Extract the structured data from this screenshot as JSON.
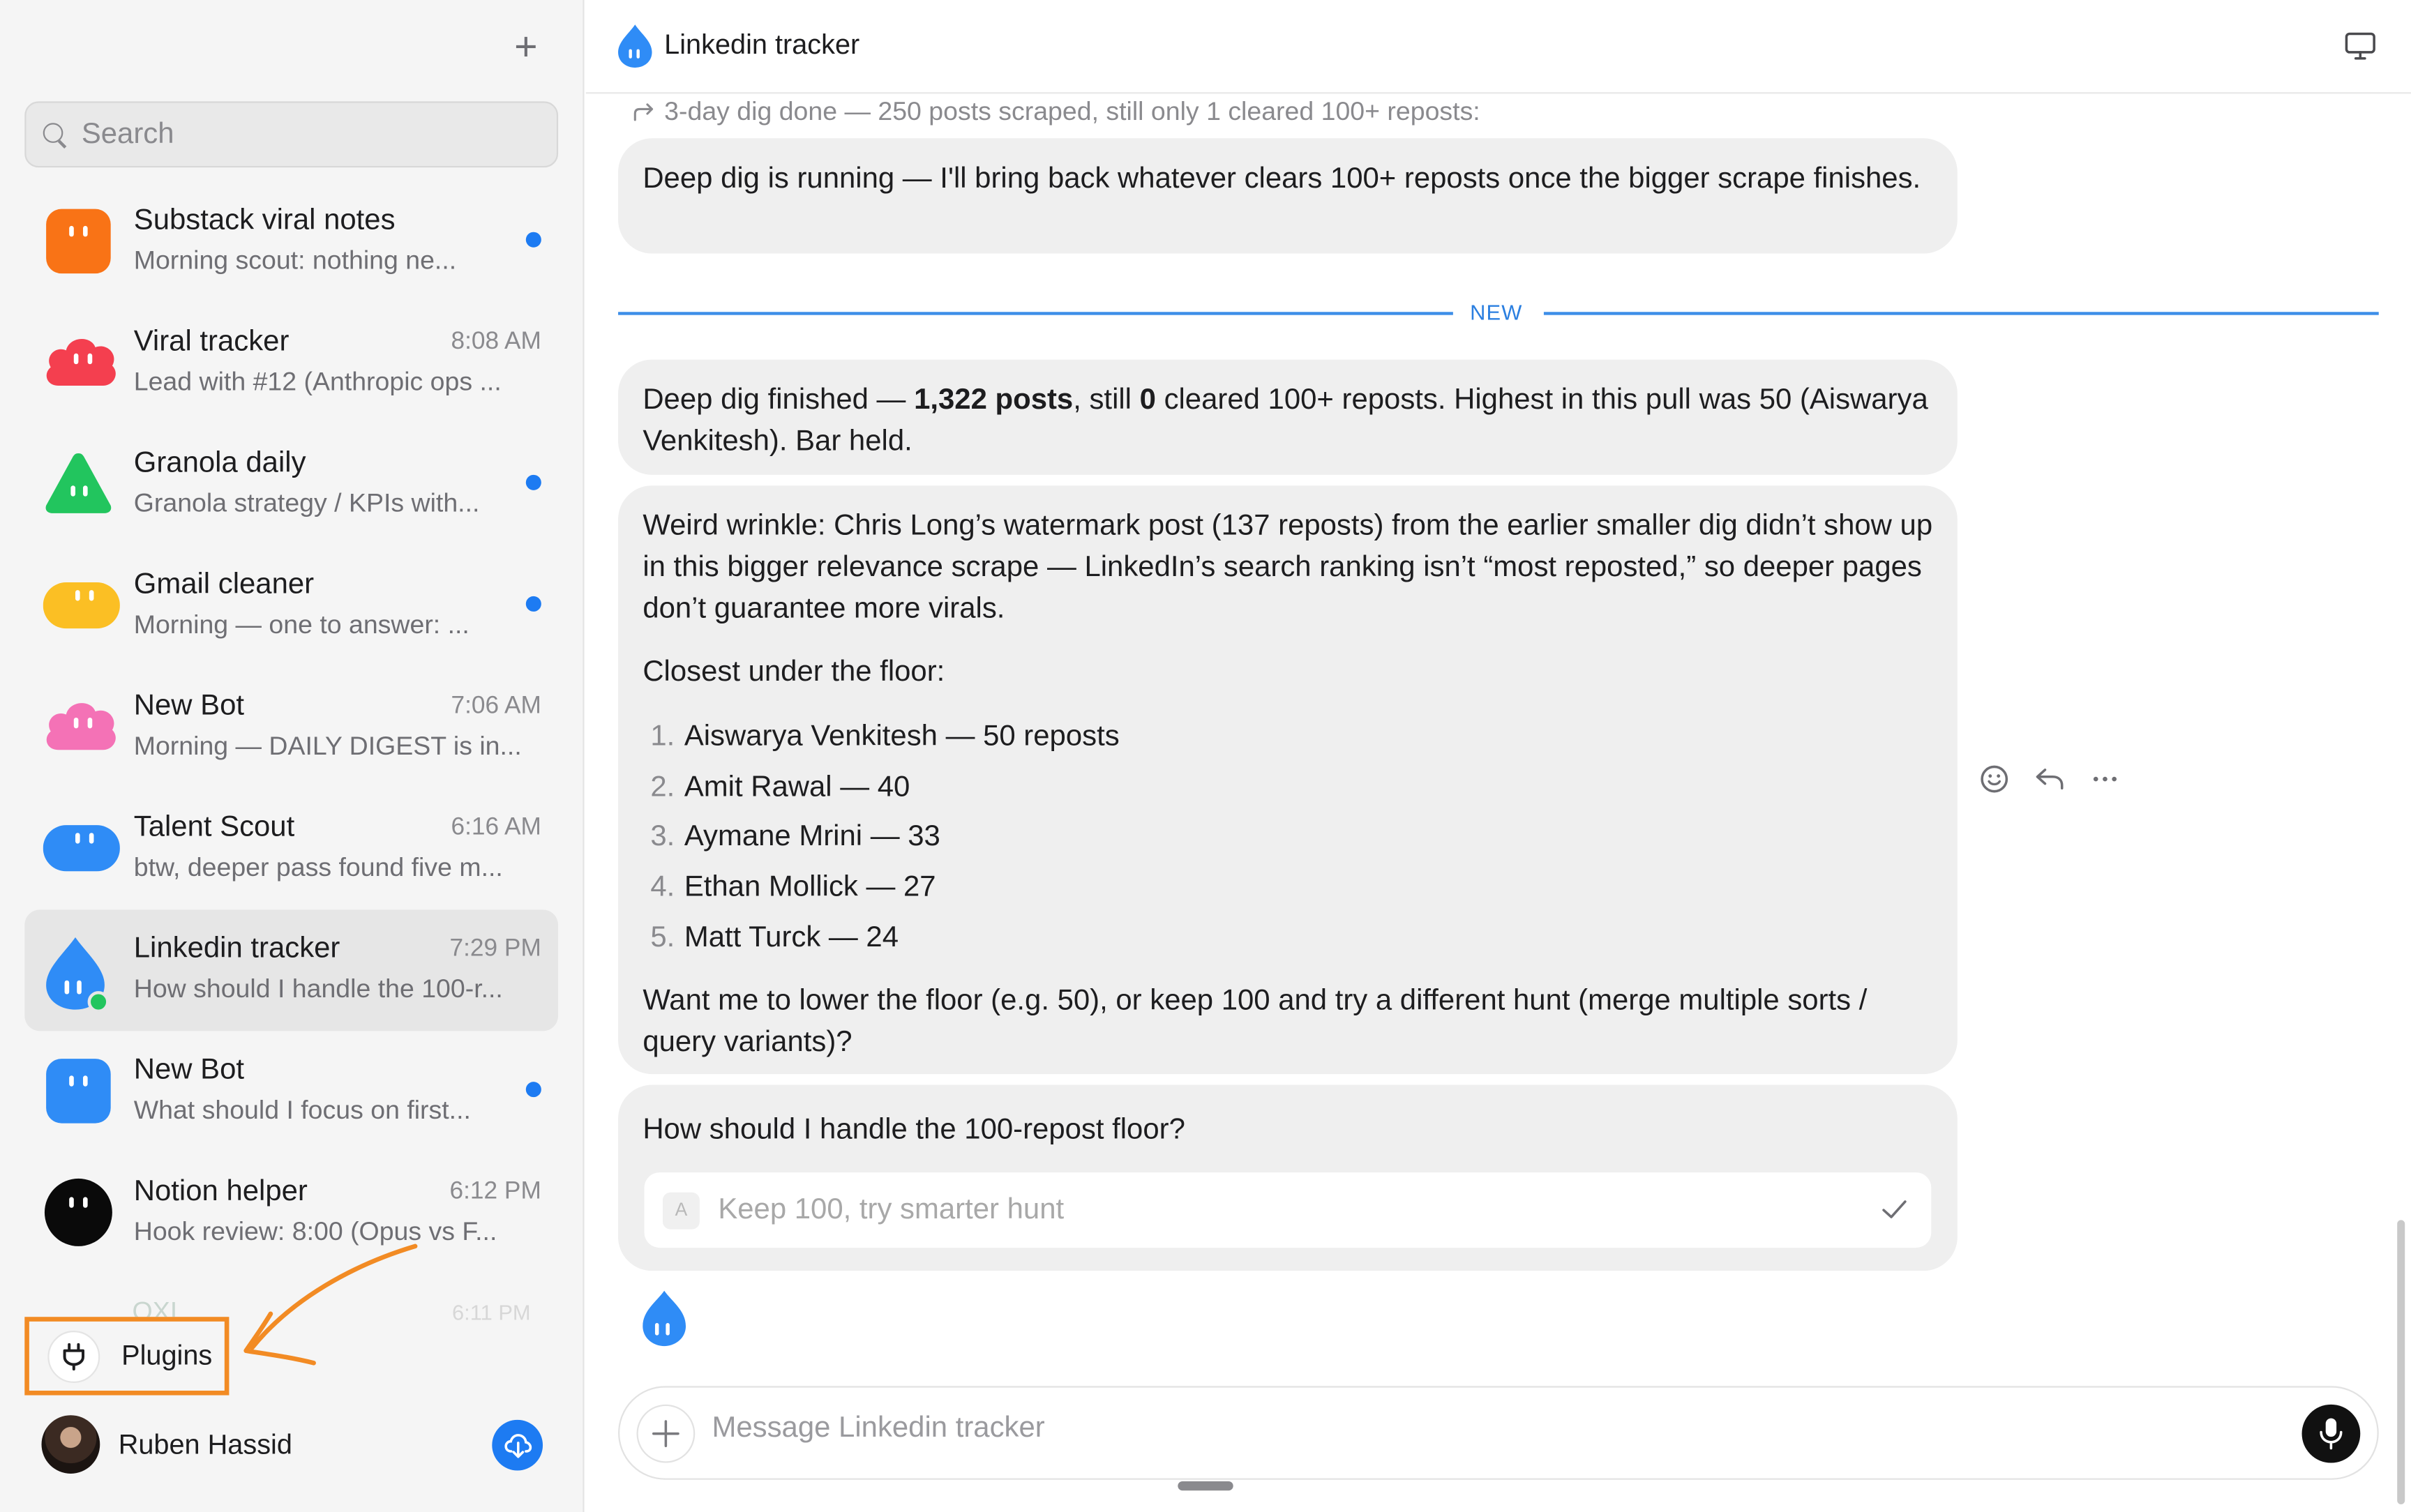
{
  "sidebar": {
    "new_chat_label": "+",
    "search": {
      "placeholder": "Search"
    },
    "chats": [
      {
        "name": "Substack viral notes",
        "preview": "Morning scout: nothing ne...",
        "time": "",
        "unread": true,
        "avatar_color": "#f97316",
        "avatar_shape": "rounded-square"
      },
      {
        "name": "Viral tracker",
        "preview": "Lead with #12 (Anthropic ops ...",
        "time": "8:08 AM",
        "unread": false,
        "avatar_color": "#f43f4f",
        "avatar_shape": "cloud"
      },
      {
        "name": "Granola daily",
        "preview": "Granola strategy / KPIs with...",
        "time": "",
        "unread": true,
        "avatar_color": "#22c55e",
        "avatar_shape": "triangle"
      },
      {
        "name": "Gmail cleaner",
        "preview": "Morning — one to answer: ...",
        "time": "",
        "unread": true,
        "avatar_color": "#fbbf24",
        "avatar_shape": "pill"
      },
      {
        "name": "New Bot",
        "preview": "Morning — DAILY DIGEST is in...",
        "time": "7:06 AM",
        "unread": false,
        "avatar_color": "#f472b6",
        "avatar_shape": "cloud"
      },
      {
        "name": "Talent Scout",
        "preview": "btw, deeper pass found five m...",
        "time": "6:16 AM",
        "unread": false,
        "avatar_color": "#2f8cf6",
        "avatar_shape": "pill"
      },
      {
        "name": "Linkedin tracker",
        "preview": "How should I handle the 100-r...",
        "time": "7:29 PM",
        "unread": false,
        "avatar_color": "#2f8cf6",
        "avatar_shape": "drop",
        "active": true,
        "online": true
      },
      {
        "name": "New Bot",
        "preview": "What should I focus on first...",
        "time": "",
        "unread": true,
        "avatar_color": "#2f8cf6",
        "avatar_shape": "rounded-square"
      },
      {
        "name": "Notion helper",
        "preview": "Hook review: 8:00 (Opus vs F...",
        "time": "6:12 PM",
        "unread": false,
        "avatar_color": "#0a0a0a",
        "avatar_shape": "circle"
      }
    ],
    "faded_row": {
      "name": "OXI...",
      "time": "6:11 PM"
    },
    "plugins_label": "Plugins",
    "profile_name": "Ruben Hassid"
  },
  "header": {
    "title": "Linkedin tracker"
  },
  "messages": {
    "forward_note": "3-day dig done — 250 posts scraped, still only 1 cleared 100+ reposts:",
    "m1": "Deep dig is running — I'll bring back whatever clears 100+ reposts once the bigger scrape finishes.",
    "new_label": "NEW",
    "m2_a": "Deep dig finished — ",
    "m2_b": "1,322 posts",
    "m2_c": ", still ",
    "m2_d": "0",
    "m2_e": " cleared 100+ reposts. Highest in this pull was 50 (Aiswarya Venkitesh). Bar held.",
    "m3_p1": "Weird wrinkle: Chris Long’s watermark post (137 reposts) from the earlier smaller dig didn’t show up in this bigger relevance scrape — LinkedIn’s search ranking isn’t “most reposted,” so deeper pages don’t guarantee more virals.",
    "m3_p2": "Closest under the floor:",
    "m3_list": [
      {
        "n": "1.",
        "text": "Aiswarya Venkitesh — 50 reposts"
      },
      {
        "n": "2.",
        "text": "Amit Rawal — 40"
      },
      {
        "n": "3.",
        "text": "Aymane Mrini — 33"
      },
      {
        "n": "4.",
        "text": "Ethan Mollick — 27"
      },
      {
        "n": "5.",
        "text": "Matt Turck — 24"
      }
    ],
    "m3_p3": "Want me to lower the floor (e.g. 50), or keep 100 and try a different hunt (merge multiple sorts / query variants)?",
    "question_title": "How should I handle the 100-repost floor?",
    "answer_badge": "A",
    "answer_text": "Keep 100, try smarter hunt"
  },
  "composer": {
    "placeholder": "Message Linkedin tracker"
  },
  "colors": {
    "accent": "#1d7bf2",
    "annotation": "#f28b24",
    "bubble": "#efefef"
  },
  "icons": [
    "plus-icon",
    "search-icon",
    "plug-icon",
    "sync-icon",
    "monitor-icon",
    "forward-icon",
    "emoji-icon",
    "reply-icon",
    "more-icon",
    "check-icon",
    "microphone-icon",
    "drop-logo-icon"
  ]
}
